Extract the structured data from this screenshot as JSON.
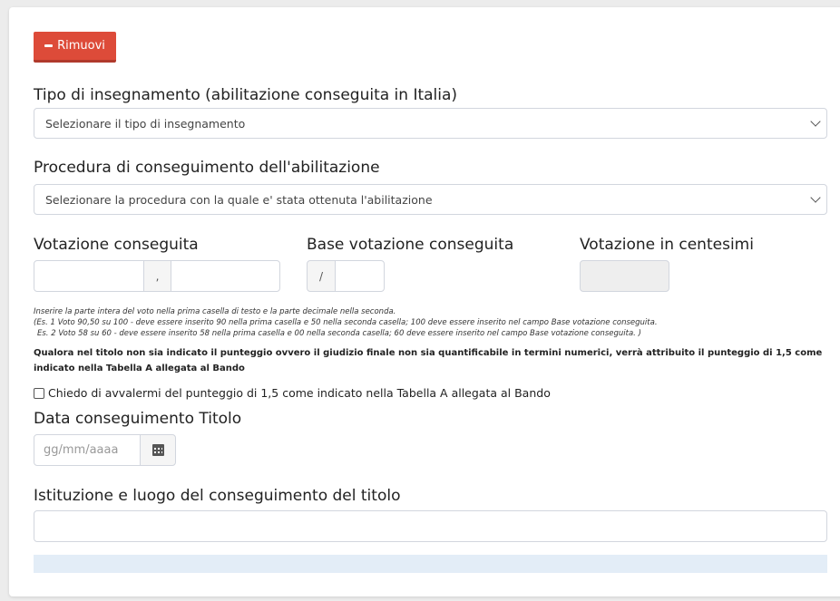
{
  "remove_button": {
    "label": "Rimuovi"
  },
  "tipo": {
    "label": "Tipo di insegnamento (abilitazione conseguita in Italia)",
    "select_value": "Selezionare il tipo di insegnamento"
  },
  "procedura": {
    "label": "Procedura di conseguimento dell'abilitazione",
    "select_value": "Selezionare la procedura con la quale e' stata ottenuta l'abilitazione"
  },
  "votazione": {
    "label": "Votazione conseguita",
    "int_value": "",
    "separator": ",",
    "dec_value": ""
  },
  "base": {
    "label": "Base votazione conseguita",
    "separator": "/",
    "value": ""
  },
  "centesimi": {
    "label": "Votazione in centesimi",
    "value": ""
  },
  "notes": {
    "line1": "Inserire la parte intera del voto nella prima casella di testo e la parte decimale nella seconda.",
    "line2": "(Es. 1 Voto 90,50 su 100 - deve essere inserito 90 nella prima casella e 50 nella seconda casella; 100 deve essere inserito nel campo Base votazione conseguita.",
    "line3": "Es. 2 Voto 58 su 60 - deve essere inserito 58 nella prima casella e 00 nella seconda casella; 60 deve essere inserito nel campo Base votazione conseguita. )",
    "bold": "Qualora nel titolo non sia indicato il punteggio ovvero il giudizio finale non sia quantificabile in termini numerici, verrà attribuito il punteggio di 1,5 come indicato nella Tabella A allegata al Bando"
  },
  "checkbox": {
    "label": "Chiedo di avvalermi del punteggio di 1,5 come indicato nella Tabella A allegata al Bando",
    "checked": false
  },
  "data": {
    "label": "Data conseguimento Titolo",
    "placeholder": "gg/mm/aaaa",
    "icon": "calendar-icon"
  },
  "istituzione": {
    "label": "Istituzione e luogo del conseguimento del titolo",
    "value": ""
  },
  "colors": {
    "danger": "#dd4b39",
    "border": "#d2d6de",
    "info_bar": "#e3edf7"
  }
}
